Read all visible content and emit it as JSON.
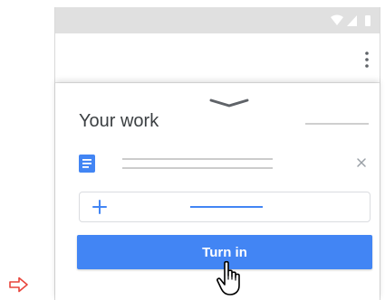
{
  "marker": {
    "icon": "arrow-right-outline-icon",
    "color": "#e8453c"
  },
  "status_bar": {
    "icons": [
      "wifi-icon",
      "signal-icon",
      "battery-icon"
    ]
  },
  "app_bar": {
    "menu_icon": "more-vert-icon"
  },
  "your_work": {
    "collapse_icon": "chevron-down-icon",
    "title": "Your work",
    "attachment": {
      "icon": "google-docs-icon",
      "remove_icon": "close-icon"
    },
    "add": {
      "icon": "plus-icon"
    },
    "turn_in_label": "Turn in",
    "pointer_icon": "hand-pointer-cursor-icon"
  },
  "colors": {
    "accent": "#4285f4",
    "status_bar": "#e0e0e0",
    "title_text": "#3c4043",
    "marker": "#e8453c"
  }
}
